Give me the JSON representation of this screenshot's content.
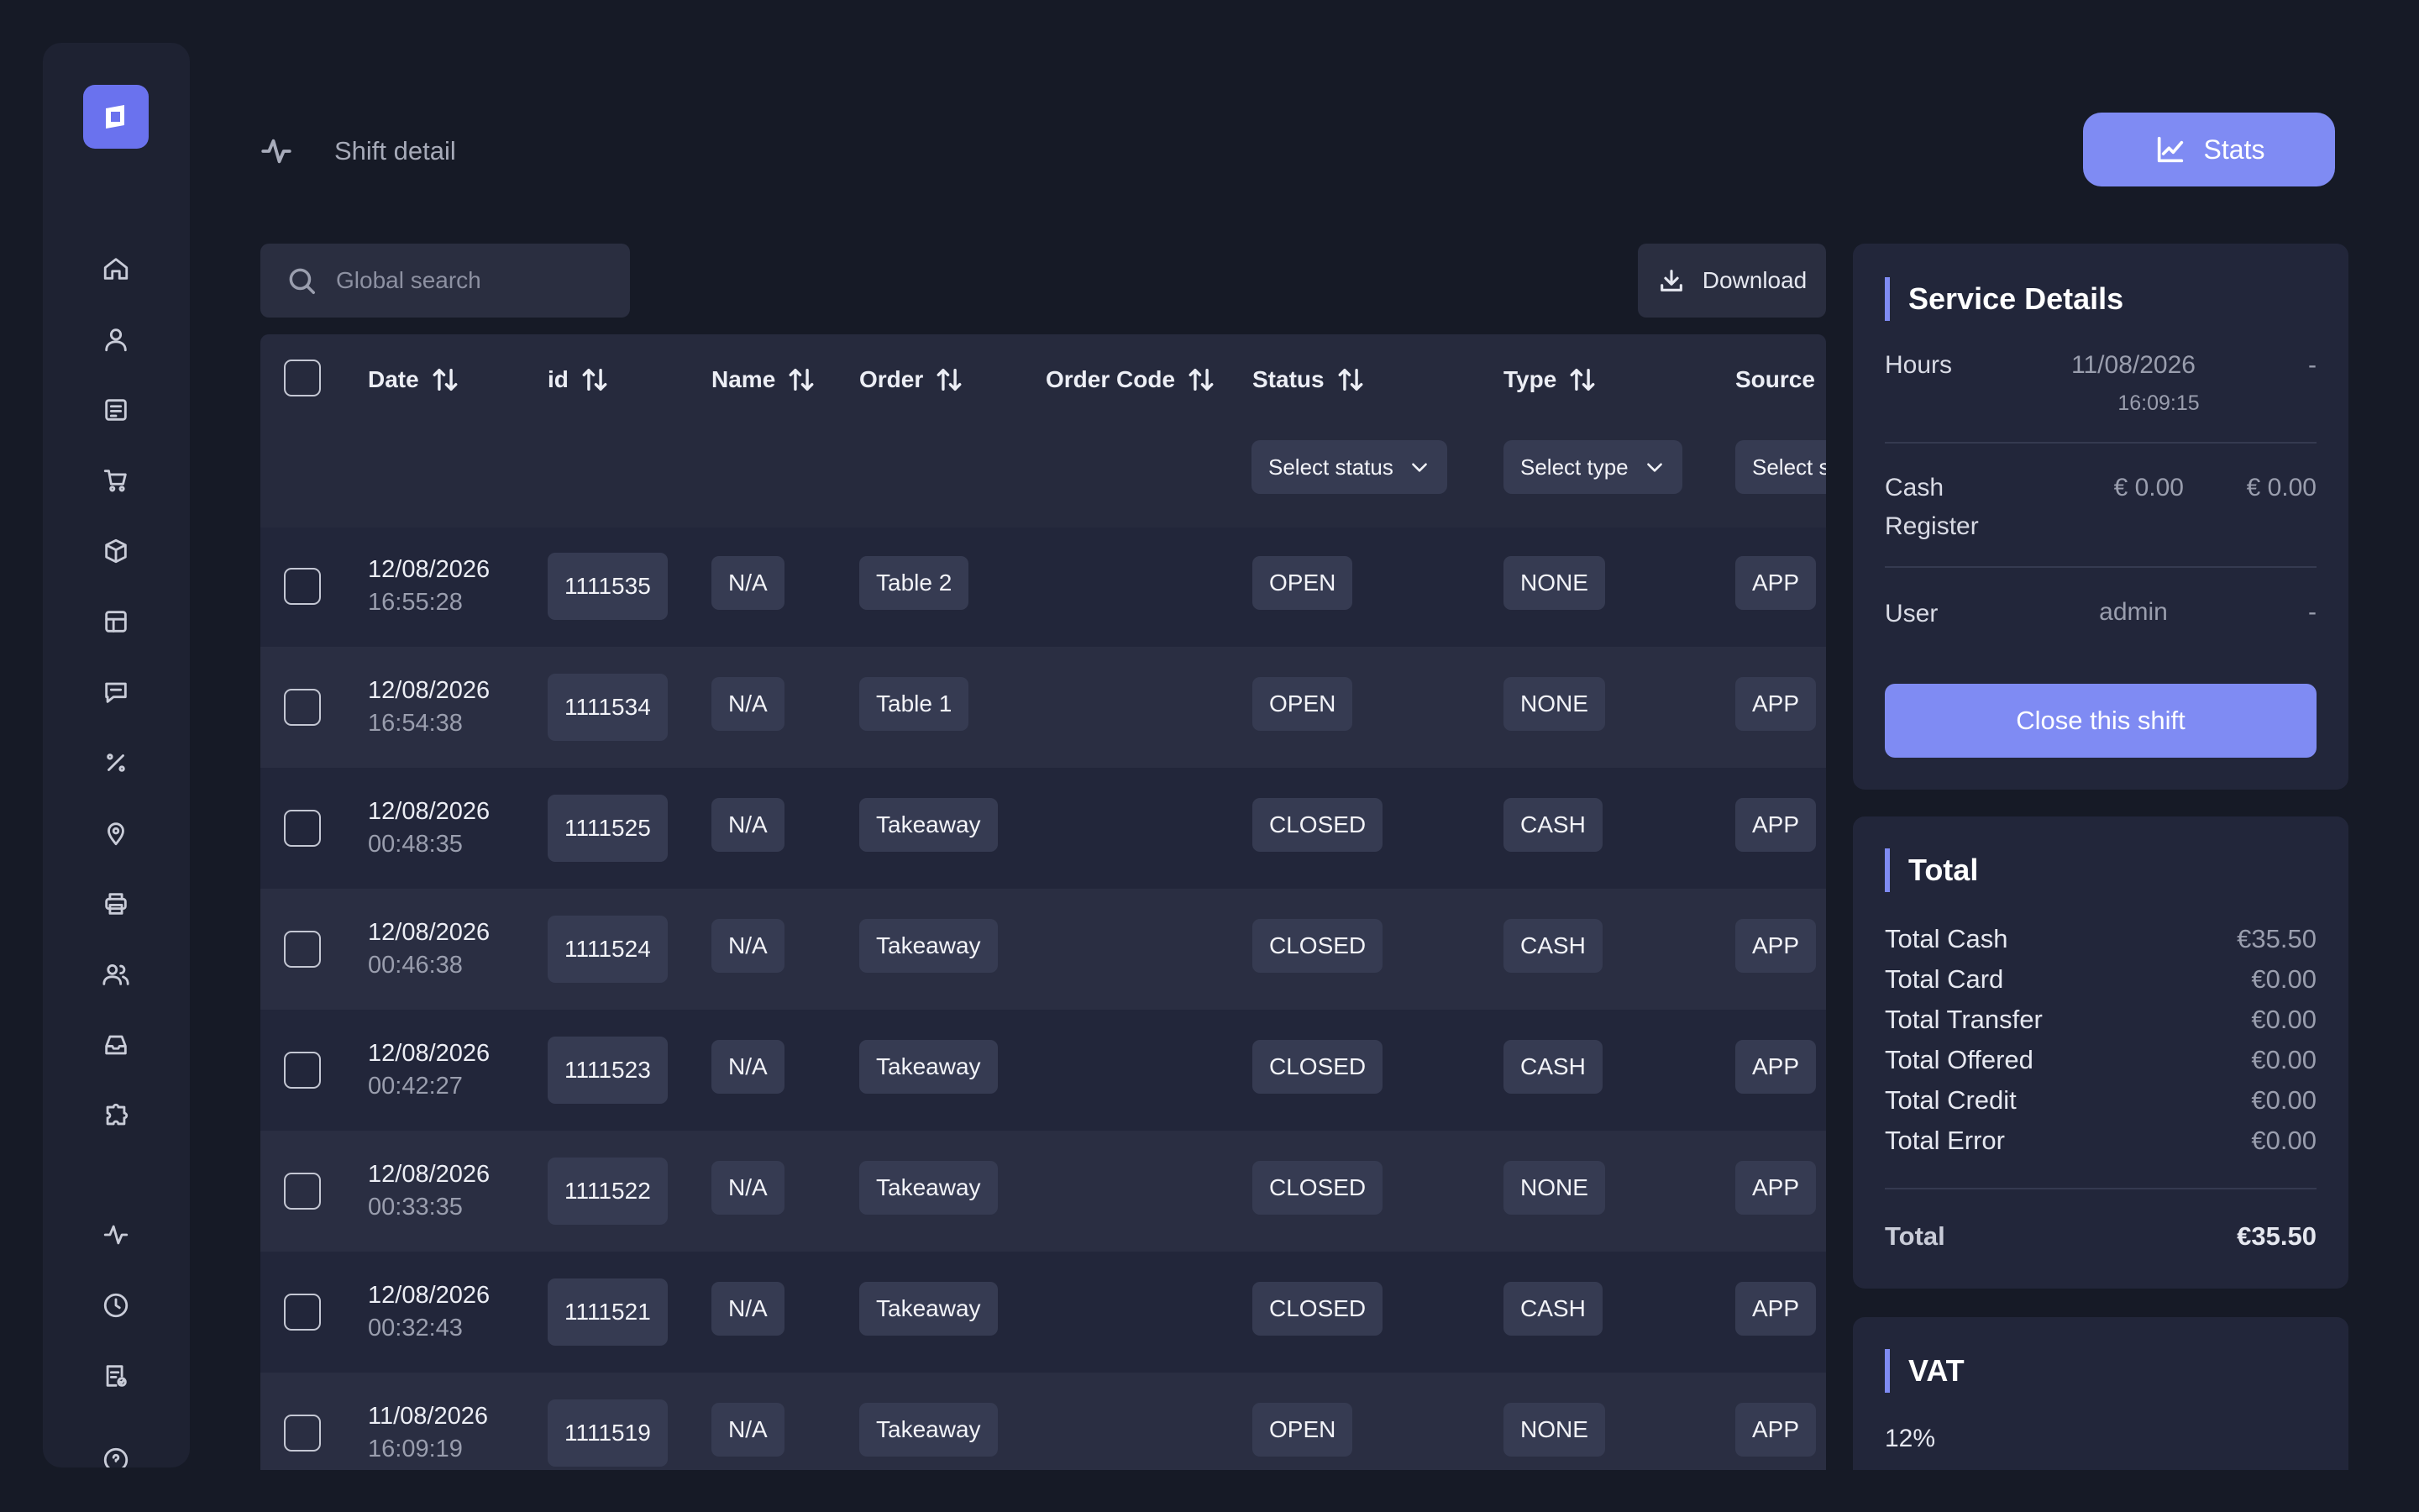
{
  "header": {
    "title": "Shift detail",
    "stats_label": "Stats"
  },
  "toolbar": {
    "search_placeholder": "Global search",
    "download_label": "Download"
  },
  "sidebar": {
    "items": [
      "home-icon",
      "user-icon",
      "receipt-icon",
      "cart-icon",
      "box-icon",
      "layout-icon",
      "chat-icon",
      "percent-icon",
      "location-icon",
      "printer-icon",
      "users-icon",
      "inbox-icon",
      "puzzle-icon",
      "activity-icon",
      "clock-icon",
      "report-icon",
      "help-icon"
    ]
  },
  "table": {
    "columns": {
      "date": "Date",
      "id": "id",
      "name": "Name",
      "order": "Order",
      "order_code": "Order Code",
      "status": "Status",
      "type": "Type",
      "source": "Source"
    },
    "filters": {
      "status": "Select status",
      "type": "Select type",
      "source": "Select s"
    },
    "rows": [
      {
        "date": "12/08/2026",
        "time": "16:55:28",
        "id": "1111535",
        "name": "N/A",
        "order": "Table 2",
        "status": "OPEN",
        "type": "NONE",
        "source": "APP"
      },
      {
        "date": "12/08/2026",
        "time": "16:54:38",
        "id": "1111534",
        "name": "N/A",
        "order": "Table 1",
        "status": "OPEN",
        "type": "NONE",
        "source": "APP"
      },
      {
        "date": "12/08/2026",
        "time": "00:48:35",
        "id": "1111525",
        "name": "N/A",
        "order": "Takeaway",
        "status": "CLOSED",
        "type": "CASH",
        "source": "APP"
      },
      {
        "date": "12/08/2026",
        "time": "00:46:38",
        "id": "1111524",
        "name": "N/A",
        "order": "Takeaway",
        "status": "CLOSED",
        "type": "CASH",
        "source": "APP"
      },
      {
        "date": "12/08/2026",
        "time": "00:42:27",
        "id": "1111523",
        "name": "N/A",
        "order": "Takeaway",
        "status": "CLOSED",
        "type": "CASH",
        "source": "APP"
      },
      {
        "date": "12/08/2026",
        "time": "00:33:35",
        "id": "1111522",
        "name": "N/A",
        "order": "Takeaway",
        "status": "CLOSED",
        "type": "NONE",
        "source": "APP"
      },
      {
        "date": "12/08/2026",
        "time": "00:32:43",
        "id": "1111521",
        "name": "N/A",
        "order": "Takeaway",
        "status": "CLOSED",
        "type": "CASH",
        "source": "APP"
      },
      {
        "date": "11/08/2026",
        "time": "16:09:19",
        "id": "1111519",
        "name": "N/A",
        "order": "Takeaway",
        "status": "OPEN",
        "type": "NONE",
        "source": "APP"
      }
    ]
  },
  "service": {
    "title": "Service Details",
    "hours_label": "Hours",
    "hours_date": "11/08/2026",
    "hours_time": "16:09:15",
    "hours_end": "-",
    "cash_label_1": "Cash",
    "cash_label_2": "Register",
    "cash_open": "€ 0.00",
    "cash_close": "€ 0.00",
    "user_label": "User",
    "user_value": "admin",
    "user_end": "-",
    "close_label": "Close this shift"
  },
  "totals": {
    "title": "Total",
    "rows": [
      {
        "label": "Total Cash",
        "value": "€35.50"
      },
      {
        "label": "Total Card",
        "value": "€0.00"
      },
      {
        "label": "Total Transfer",
        "value": "€0.00"
      },
      {
        "label": "Total Offered",
        "value": "€0.00"
      },
      {
        "label": "Total Credit",
        "value": "€0.00"
      },
      {
        "label": "Total Error",
        "value": "€0.00"
      }
    ],
    "total_label": "Total",
    "total_value": "€35.50"
  },
  "vat": {
    "title": "VAT",
    "rate": "12%"
  },
  "colors": {
    "accent": "#7f8bf3",
    "logo": "#6a72ee",
    "background": "#161a26",
    "panel": "#22263a"
  }
}
